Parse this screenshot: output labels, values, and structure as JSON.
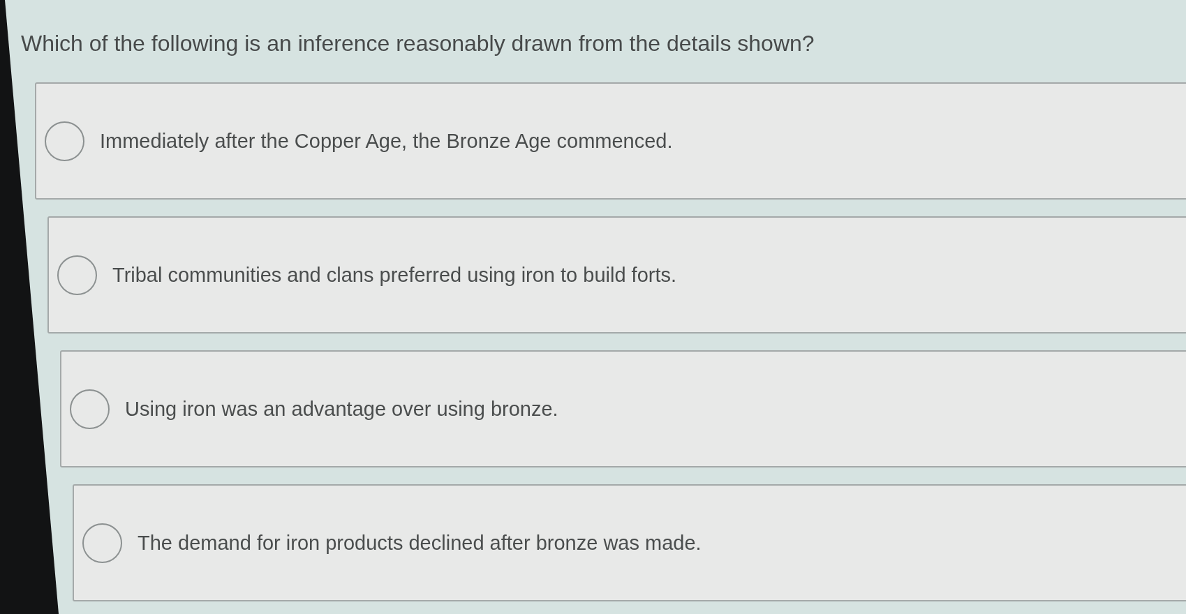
{
  "question": "Which of the following is an inference reasonably drawn from the details shown?",
  "options": [
    {
      "text": "Immediately after the Copper Age, the Bronze Age commenced.",
      "selected": false
    },
    {
      "text": "Tribal communities and clans preferred using iron to build forts.",
      "selected": false
    },
    {
      "text": "Using iron was an advantage over using bronze.",
      "selected": false
    },
    {
      "text": "The demand for iron products declined after bronze was made.",
      "selected": false
    }
  ]
}
